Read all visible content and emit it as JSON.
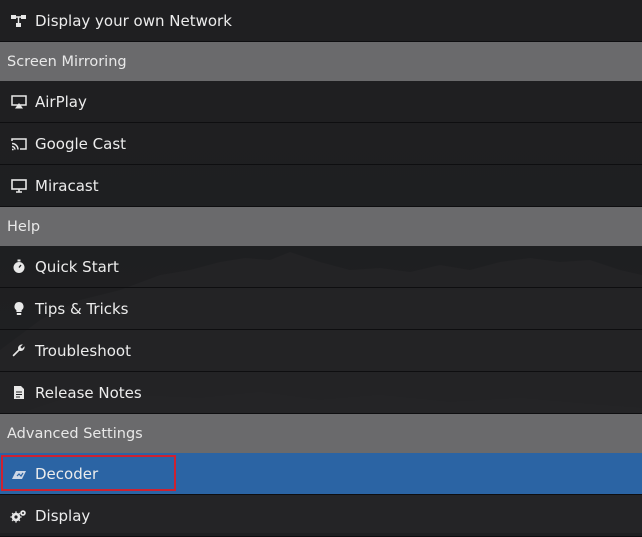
{
  "menu": {
    "network_item": {
      "label": "Display your own Network",
      "icon": "network-icon"
    },
    "screen_mirroring": {
      "header": "Screen Mirroring",
      "items": [
        {
          "label": "AirPlay",
          "icon": "airplay-icon"
        },
        {
          "label": "Google Cast",
          "icon": "cast-icon"
        },
        {
          "label": "Miracast",
          "icon": "monitor-icon"
        }
      ]
    },
    "help": {
      "header": "Help",
      "items": [
        {
          "label": "Quick Start",
          "icon": "stopwatch-icon"
        },
        {
          "label": "Tips & Tricks",
          "icon": "lightbulb-icon"
        },
        {
          "label": "Troubleshoot",
          "icon": "wrench-icon"
        },
        {
          "label": "Release Notes",
          "icon": "document-icon"
        }
      ]
    },
    "advanced_settings": {
      "header": "Advanced Settings",
      "items": [
        {
          "label": "Decoder",
          "icon": "decoder-icon",
          "selected": true
        },
        {
          "label": "Display",
          "icon": "gears-icon"
        }
      ]
    }
  },
  "colors": {
    "header_bg": "#6a6a6c",
    "selected_bg": "#2b64a4",
    "highlight_border": "#cd2230",
    "text": "#ececec"
  }
}
